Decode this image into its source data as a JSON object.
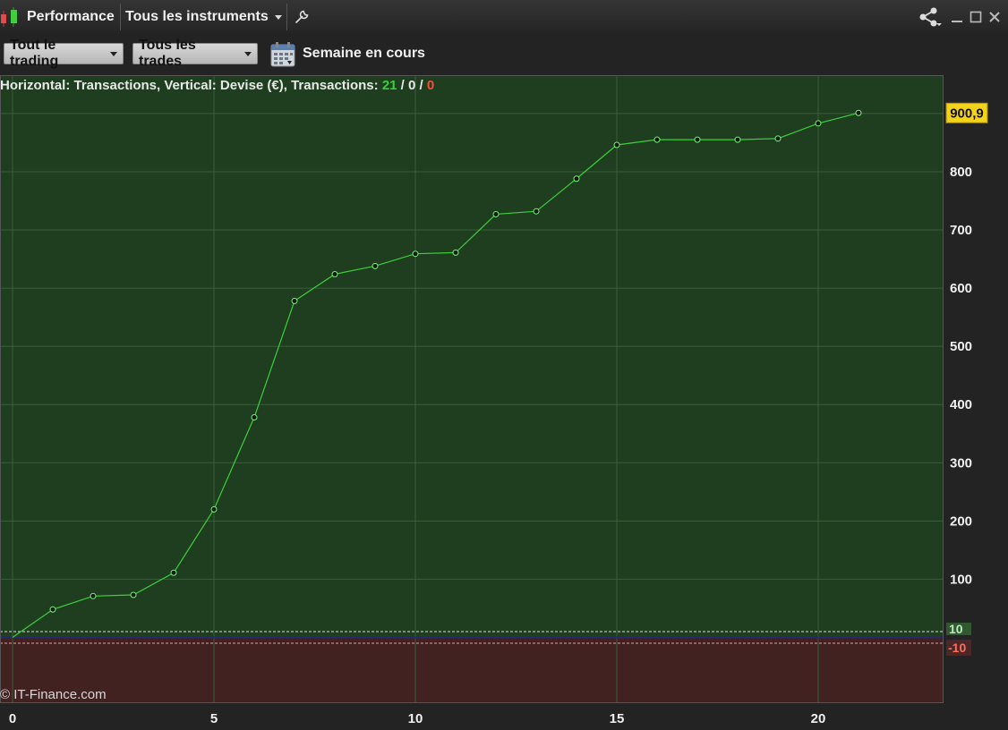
{
  "titlebar": {
    "title": "Performance",
    "instrument_selector": "Tous les instruments",
    "icons": [
      "candlestick-icon",
      "wrench-icon",
      "share-icon",
      "minimize-icon",
      "maximize-icon",
      "close-icon"
    ]
  },
  "toolbar": {
    "trading_filter": "Tout le trading",
    "trades_filter": "Tous les trades",
    "period": "Semaine en cours",
    "calendar_icon": "calendar-icon"
  },
  "chart": {
    "caption_prefix": "Horizontal: Transactions, Vertical: Devise (€), Transactions:",
    "count_win": "21",
    "sep1": "/",
    "count_neutral": "0",
    "sep2": "/",
    "count_loss": "0",
    "copyright": "© IT-Finance.com",
    "last_value_label": "900,9",
    "upper_band_label": "10",
    "lower_band_label": "-10",
    "colors": {
      "profit_zone": "#1e3e1f",
      "loss_zone": "#422121",
      "line": "#3ccf3c",
      "last_value_bg": "#f2d21a"
    }
  },
  "chart_data": {
    "type": "line",
    "xlabel": "Transactions",
    "ylabel": "Devise (€)",
    "x": [
      0,
      1,
      2,
      3,
      4,
      5,
      6,
      7,
      8,
      9,
      10,
      11,
      12,
      13,
      14,
      15,
      16,
      17,
      18,
      19,
      20,
      21
    ],
    "values": [
      0,
      48,
      71,
      73,
      111,
      220,
      378,
      578,
      624,
      638,
      659,
      661,
      727,
      732,
      788,
      846,
      855,
      855,
      855,
      857,
      883,
      900.9
    ],
    "xlim": [
      0,
      23.1
    ],
    "ylim": [
      -25,
      990
    ],
    "x_ticks": [
      0,
      5,
      10,
      15,
      20
    ],
    "y_ticks": [
      100,
      200,
      300,
      400,
      500,
      600,
      700,
      800
    ],
    "band": [
      -10,
      10
    ],
    "grid": true
  }
}
